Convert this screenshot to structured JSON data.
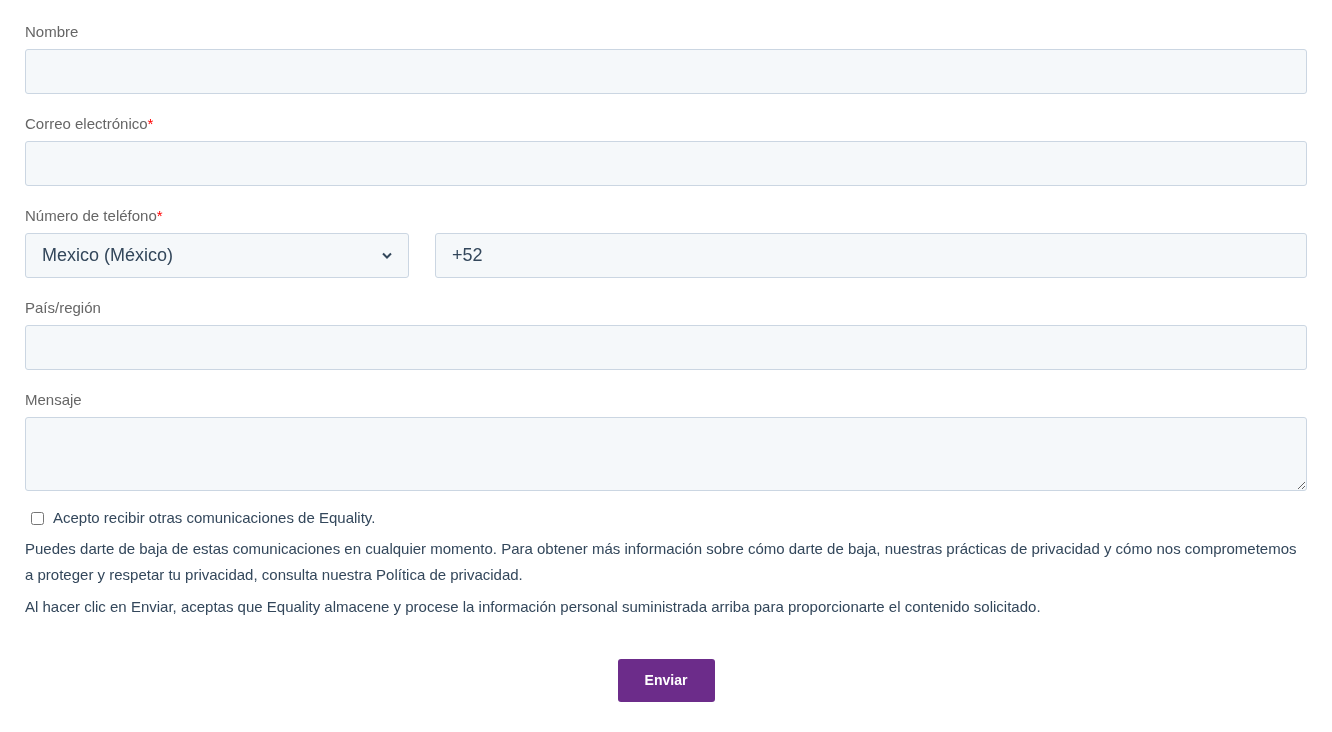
{
  "fields": [
    {
      "kind": "text",
      "label": "Nombre"
    },
    {
      "kind": "text",
      "label": "Correo electrónico",
      "required_mark": "*"
    },
    {
      "kind": "phone",
      "label": "Número de teléfono",
      "required_mark": "*",
      "country": "Mexico (México)",
      "value": "+52"
    },
    {
      "kind": "text",
      "label": "País/región"
    },
    {
      "kind": "textarea",
      "label": "Mensaje"
    }
  ],
  "consent": {
    "label": "Acepto recibir otras comunicaciones de Equality.",
    "checked": false
  },
  "notices": [
    "Puedes darte de baja de estas comunicaciones en cualquier momento. Para obtener más información sobre cómo darte de baja, nuestras prácticas de privacidad y cómo nos comprometemos a proteger y respetar tu privacidad, consulta nuestra Política de privacidad.",
    "Al hacer clic en Enviar, aceptas que Equality almacene y procese la información personal suministrada arriba para proporcionarte el contenido solicitado."
  ],
  "submit": "Enviar"
}
